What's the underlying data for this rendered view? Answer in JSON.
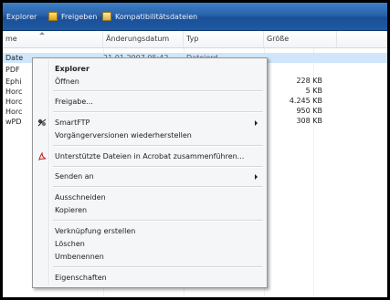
{
  "toolbar": {
    "explorer_label": "Explorer",
    "share_label": "Freigeben",
    "compat_label": "Kompatibilitätsdateien"
  },
  "columns": {
    "name": "me",
    "date": "Änderungsdatum",
    "type": "Typ",
    "size": "Größe"
  },
  "files": [
    {
      "name": "Date",
      "date": "21.01.2007 05:42",
      "type": "Dateiord"
    },
    {
      "name": "PDF"
    },
    {
      "name": "Ephi"
    },
    {
      "name": "Horc"
    },
    {
      "name": "Horc"
    },
    {
      "name": "Horc"
    },
    {
      "name": "wPD"
    }
  ],
  "sizes": [
    "228 KB",
    "5 KB",
    "4.245 KB",
    "950 KB",
    "308 KB"
  ],
  "menu": {
    "items": [
      {
        "label": "Explorer"
      },
      {
        "label": "Öffnen"
      },
      {
        "label": "Freigabe..."
      },
      {
        "label": "SmartFTP"
      },
      {
        "label": "Vorgängerversionen wiederherstellen"
      },
      {
        "label": "Unterstützte Dateien in Acrobat zusammenführen..."
      },
      {
        "label": "Senden an"
      },
      {
        "label": "Ausschneiden"
      },
      {
        "label": "Kopieren"
      },
      {
        "label": "Verknüpfung erstellen"
      },
      {
        "label": "Löschen"
      },
      {
        "label": "Umbenennen"
      },
      {
        "label": "Eigenschaften"
      }
    ]
  },
  "colors": {
    "toolbar": "#2a62aa",
    "selection": "#cfe6fb",
    "menu_bg": "#f5f6f7"
  }
}
